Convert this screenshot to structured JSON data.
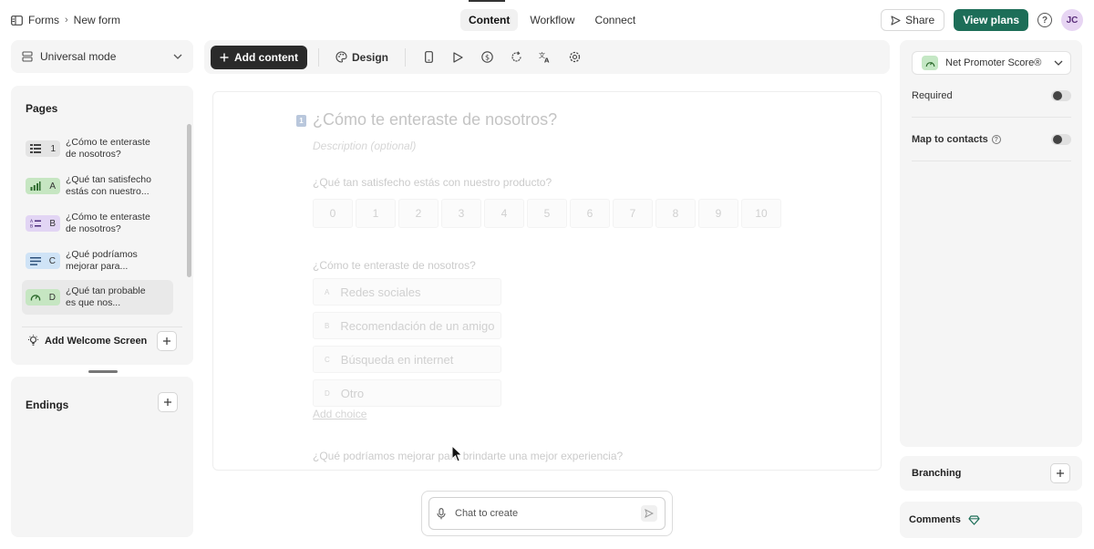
{
  "topbar": {
    "breadcrumb": {
      "root": "Forms",
      "current": "New form"
    },
    "tabs": [
      {
        "label": "Content",
        "active": true
      },
      {
        "label": "Workflow",
        "active": false
      },
      {
        "label": "Connect",
        "active": false
      }
    ],
    "share_label": "Share",
    "view_plans_label": "View plans",
    "help_glyph": "?",
    "avatar_initials": "JC",
    "accent_color": "#1d6e58"
  },
  "sidebar": {
    "mode_label": "Universal mode",
    "pages_title": "Pages",
    "pages": [
      {
        "key": "1",
        "line1": "¿Cómo te enteraste",
        "line2": "de nosotros?",
        "icon": "list-icon",
        "color": "#e4e4e4"
      },
      {
        "key": "A",
        "line1": "¿Qué tan satisfecho",
        "line2": "estás con nuestro...",
        "icon": "bar-chart-icon",
        "color": "#c6e6c2"
      },
      {
        "key": "B",
        "line1": "¿Cómo te enteraste",
        "line2": "de nosotros?",
        "icon": "multiple-choice-icon",
        "color": "#e2d5f4"
      },
      {
        "key": "C",
        "line1": "¿Qué podríamos",
        "line2": "mejorar para...",
        "icon": "text-lines-icon",
        "color": "#cfe3f6"
      },
      {
        "key": "D",
        "line1": "¿Qué tan probable",
        "line2": "es que nos...",
        "icon": "gauge-icon",
        "color": "#c6e6c2"
      }
    ],
    "welcome_label": "Add Welcome Screen",
    "endings_title": "Endings"
  },
  "toolbar": {
    "add_content_label": "Add content",
    "design_label": "Design",
    "icons": [
      "mobile-preview-icon",
      "play-icon",
      "dollar-icon",
      "refresh-icon",
      "translate-icon",
      "settings-icon"
    ]
  },
  "canvas": {
    "q_number": "1",
    "title": "¿Cómo te enteraste de nosotros?",
    "description_placeholder": "Description (optional)",
    "question2": "¿Qué tan satisfecho estás con nuestro producto?",
    "nps_scale": [
      "0",
      "1",
      "2",
      "3",
      "4",
      "5",
      "6",
      "7",
      "8",
      "9",
      "10"
    ],
    "question3": "¿Cómo te enteraste de nosotros?",
    "choices": [
      {
        "key": "A",
        "label": "Redes sociales"
      },
      {
        "key": "B",
        "label": "Recomendación de un amigo"
      },
      {
        "key": "C",
        "label": "Búsqueda en internet"
      },
      {
        "key": "D",
        "label": "Otro"
      }
    ],
    "add_choice": "Add choice",
    "question4": "¿Qué podríamos mejorar para brindarte una mejor experiencia?"
  },
  "chat": {
    "placeholder": "Chat to create"
  },
  "right_panel": {
    "question_type": "Net Promoter Score®",
    "required_label": "Required",
    "map_contacts_label": "Map to contacts",
    "info_glyph": "?",
    "branching_label": "Branching",
    "comments_label": "Comments"
  }
}
